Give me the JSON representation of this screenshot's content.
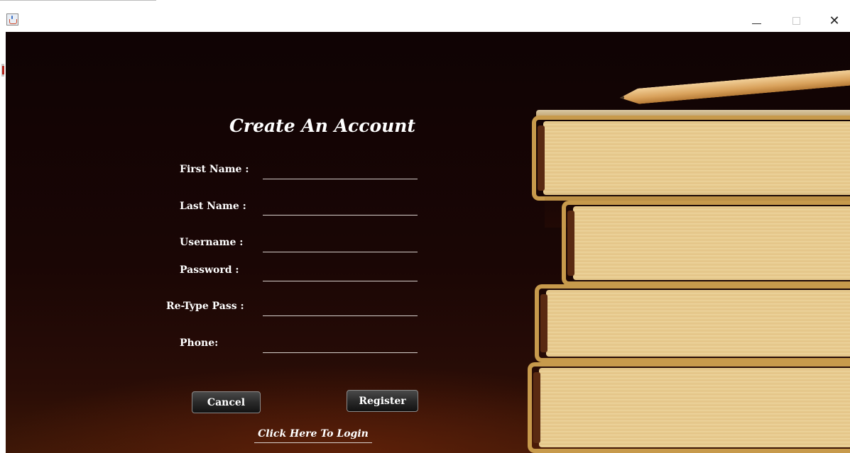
{
  "window": {
    "controls": {
      "minimize": "minimize-icon",
      "maximize": "maximize-icon",
      "close_label": "✕"
    },
    "icon": "java-cup-icon"
  },
  "form": {
    "title": "Create An Account",
    "fields": [
      {
        "label": "First Name :",
        "value": ""
      },
      {
        "label": "Last Name :",
        "value": ""
      },
      {
        "label": "Username :",
        "value": ""
      },
      {
        "label": "Password :",
        "value": ""
      },
      {
        "label": "Re-Type Pass :",
        "value": ""
      },
      {
        "label": "Phone:",
        "value": ""
      }
    ],
    "buttons": {
      "cancel": "Cancel",
      "register": "Register"
    },
    "login_link": "Click Here To Login"
  },
  "colors": {
    "background": "#1a0605",
    "text": "#ffffff",
    "book_pages": "#e9cf95"
  }
}
